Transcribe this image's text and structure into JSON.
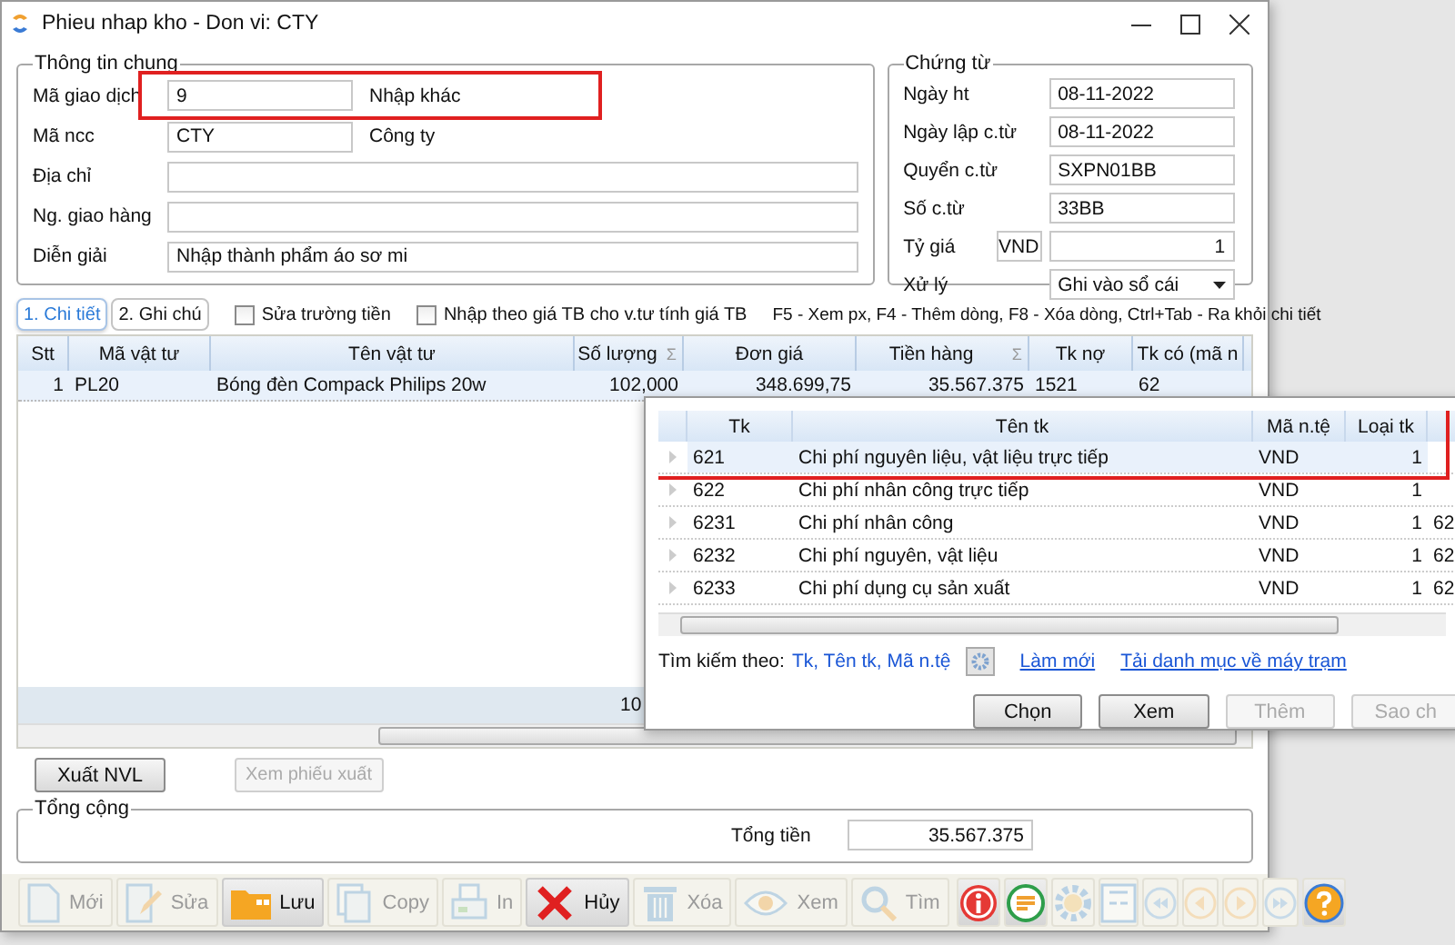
{
  "window": {
    "title": "Phieu nhap kho - Don vi: CTY"
  },
  "general": {
    "title": "Thông tin chung",
    "fields": [
      {
        "label": "Mã giao dịch",
        "value": "9",
        "description": "Nhập khác",
        "kind": "short",
        "highlighted": true
      },
      {
        "label": "Mã ncc",
        "value": "CTY",
        "description": "Công ty",
        "kind": "short",
        "highlighted": false
      },
      {
        "label": "Địa chỉ",
        "kind": "wide",
        "highlighted": false
      },
      {
        "label": "Ng. giao hàng",
        "kind": "wide",
        "highlighted": false
      },
      {
        "label": "Diễn giải",
        "value": "Nhập thành phẩm áo sơ mi",
        "kind": "wide",
        "highlighted": false
      }
    ]
  },
  "voucher": {
    "title": "Chứng từ",
    "fields": [
      {
        "label": "Ngày ht",
        "value": "08-11-2022",
        "kind": "text"
      },
      {
        "label": "Ngày lập c.từ",
        "value": "08-11-2022",
        "kind": "text"
      },
      {
        "label": "Quyển c.từ",
        "value": "SXPN01BB",
        "kind": "text"
      },
      {
        "label": "Số c.từ",
        "value": "33BB",
        "kind": "text"
      },
      {
        "label": "Tỷ giá",
        "currency": "VND",
        "value": "1",
        "kind": "rate"
      },
      {
        "label": "Xử lý",
        "value": "Ghi vào sổ cái",
        "kind": "select"
      }
    ]
  },
  "tabs": [
    {
      "label": "1. Chi tiết",
      "selected": true
    },
    {
      "label": "2. Ghi chú",
      "selected": false
    }
  ],
  "options": [
    {
      "label": "Sửa trường tiền",
      "checked": false
    },
    {
      "label": "Nhập theo giá TB cho v.tư tính giá TB",
      "checked": false
    }
  ],
  "hint": "F5 - Xem px, F4 - Thêm dòng, F8 - Xóa dòng, Ctrl+Tab - Ra khỏi chi tiết",
  "grid": {
    "columns": [
      {
        "label": "Stt"
      },
      {
        "label": "Mã vật tư"
      },
      {
        "label": "Tên vật tư"
      },
      {
        "label": "Số lượng",
        "sum": "Σ"
      },
      {
        "label": "Đơn giá"
      },
      {
        "label": "Tiền hàng",
        "sum": "Σ"
      },
      {
        "label": "Tk nợ"
      },
      {
        "label": "Tk có (mã n"
      }
    ],
    "rows": [
      {
        "selected": true,
        "cells": [
          "1",
          "PL20",
          "Bóng đèn Compack Philips 20w",
          "102,000",
          "348.699,75",
          "35.567.375",
          "1521",
          "62"
        ]
      }
    ],
    "footer_total": "10"
  },
  "lookup": {
    "columns": [
      "Tk",
      "Tên tk",
      "Mã n.tệ",
      "Loại tk"
    ],
    "rows": [
      {
        "selected": true,
        "highlighted": true,
        "cells": [
          "621",
          "Chi phí nguyên liệu, vật liệu trực tiếp",
          "VND",
          "1"
        ]
      },
      {
        "selected": false,
        "highlighted": false,
        "cells": [
          "622",
          "Chi phí nhân công trực tiếp",
          "VND",
          "1"
        ]
      },
      {
        "selected": false,
        "highlighted": false,
        "cells": [
          "6231",
          "Chi phí nhân công",
          "VND",
          "1",
          "62"
        ]
      },
      {
        "selected": false,
        "highlighted": false,
        "cells": [
          "6232",
          "Chi phí nguyên, vật liệu",
          "VND",
          "1",
          "62"
        ]
      },
      {
        "selected": false,
        "highlighted": false,
        "cells": [
          "6233",
          "Chi phí dụng cụ sản xuất",
          "VND",
          "1",
          "62"
        ]
      }
    ],
    "search_label": "Tìm kiếm theo:",
    "search_fields": "Tk, Tên tk, Mã n.tệ",
    "links": [
      "Làm mới",
      "Tải danh mục về máy trạm"
    ],
    "buttons": [
      {
        "label": "Chọn",
        "disabled": false
      },
      {
        "label": "Xem",
        "disabled": false
      },
      {
        "label": "Thêm",
        "disabled": true
      },
      {
        "label": "Sao ch",
        "disabled": true
      }
    ]
  },
  "actions": [
    {
      "label": "Xuất NVL",
      "disabled": false
    },
    {
      "label": "Xem phiếu xuất",
      "disabled": true
    }
  ],
  "totals": {
    "title": "Tổng cộng",
    "label": "Tổng tiền",
    "value": "35.567.375"
  },
  "toolbar": [
    {
      "kind": "new",
      "label": "Mới",
      "disabled": true
    },
    {
      "kind": "edit",
      "label": "Sửa",
      "disabled": true
    },
    {
      "kind": "save",
      "label": "Lưu",
      "disabled": false
    },
    {
      "kind": "copy",
      "label": "Copy",
      "disabled": true
    },
    {
      "kind": "print",
      "label": "In",
      "disabled": true
    },
    {
      "kind": "cancel",
      "label": "Hủy",
      "disabled": false
    },
    {
      "kind": "delete",
      "label": "Xóa",
      "disabled": true
    },
    {
      "kind": "view",
      "label": "Xem",
      "disabled": true
    },
    {
      "kind": "find",
      "label": "Tìm",
      "disabled": true
    }
  ],
  "tools": [
    {
      "kind": "info",
      "disabled": false
    },
    {
      "kind": "notes",
      "disabled": false
    },
    {
      "kind": "settings",
      "disabled": true
    },
    {
      "kind": "form",
      "disabled": true
    },
    {
      "kind": "first",
      "disabled": true
    },
    {
      "kind": "previous",
      "disabled": true
    },
    {
      "kind": "next",
      "disabled": true
    },
    {
      "kind": "last",
      "disabled": true
    },
    {
      "kind": "help",
      "disabled": false
    }
  ]
}
